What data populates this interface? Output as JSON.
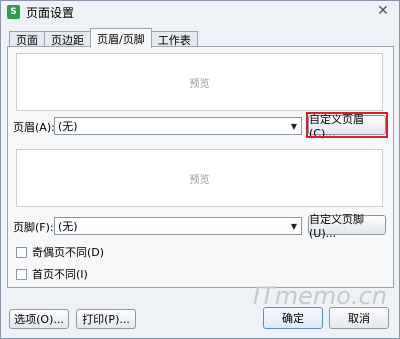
{
  "window": {
    "title": "页面设置",
    "app_icon": "S",
    "close": "✕"
  },
  "tabs": [
    {
      "label": "页面"
    },
    {
      "label": "页边距"
    },
    {
      "label": "页眉/页脚",
      "active": true
    },
    {
      "label": "工作表"
    }
  ],
  "header": {
    "preview_label": "预览",
    "label": "页眉(A):",
    "value": "(无)",
    "custom_button": "自定义页眉(C)..."
  },
  "footer": {
    "preview_label": "预览",
    "label": "页脚(F):",
    "value": "(无)",
    "custom_button": "自定义页脚(U)..."
  },
  "options": {
    "odd_even": {
      "label": "奇偶页不同(D)",
      "checked": false
    },
    "first_page": {
      "label": "首页不同(I)",
      "checked": false
    }
  },
  "buttons": {
    "options": "选项(O)...",
    "print": "打印(P)...",
    "ok": "确定",
    "cancel": "取消"
  },
  "watermark": "ITmemo.cn",
  "colors": {
    "highlight": "#d9202a",
    "app_icon": "#2e9e4e"
  }
}
